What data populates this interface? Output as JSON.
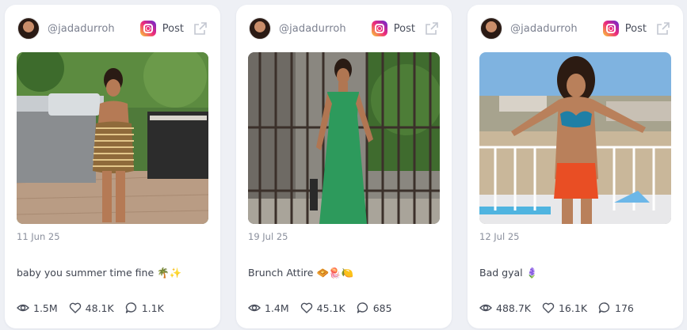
{
  "cards": [
    {
      "username": "@jadadurroh",
      "post_label": "Post",
      "date": "11 Jun 25",
      "caption": "baby you summer time fine 🌴✨",
      "views": "1.5M",
      "likes": "48.1K",
      "comments": "1.1K"
    },
    {
      "username": "@jadadurroh",
      "post_label": "Post",
      "date": "19 Jul 25",
      "caption": "Brunch Attire 🧇🪼🍋",
      "views": "1.4M",
      "likes": "45.1K",
      "comments": "685"
    },
    {
      "username": "@jadadurroh",
      "post_label": "Post",
      "date": "12 Jul 25",
      "caption": "Bad gyal 🪻",
      "views": "488.7K",
      "likes": "16.1K",
      "comments": "176"
    }
  ],
  "icons": {
    "platform": "instagram-icon",
    "external": "external-link-icon",
    "views": "eye-icon",
    "likes": "heart-icon",
    "comments": "comment-icon"
  }
}
